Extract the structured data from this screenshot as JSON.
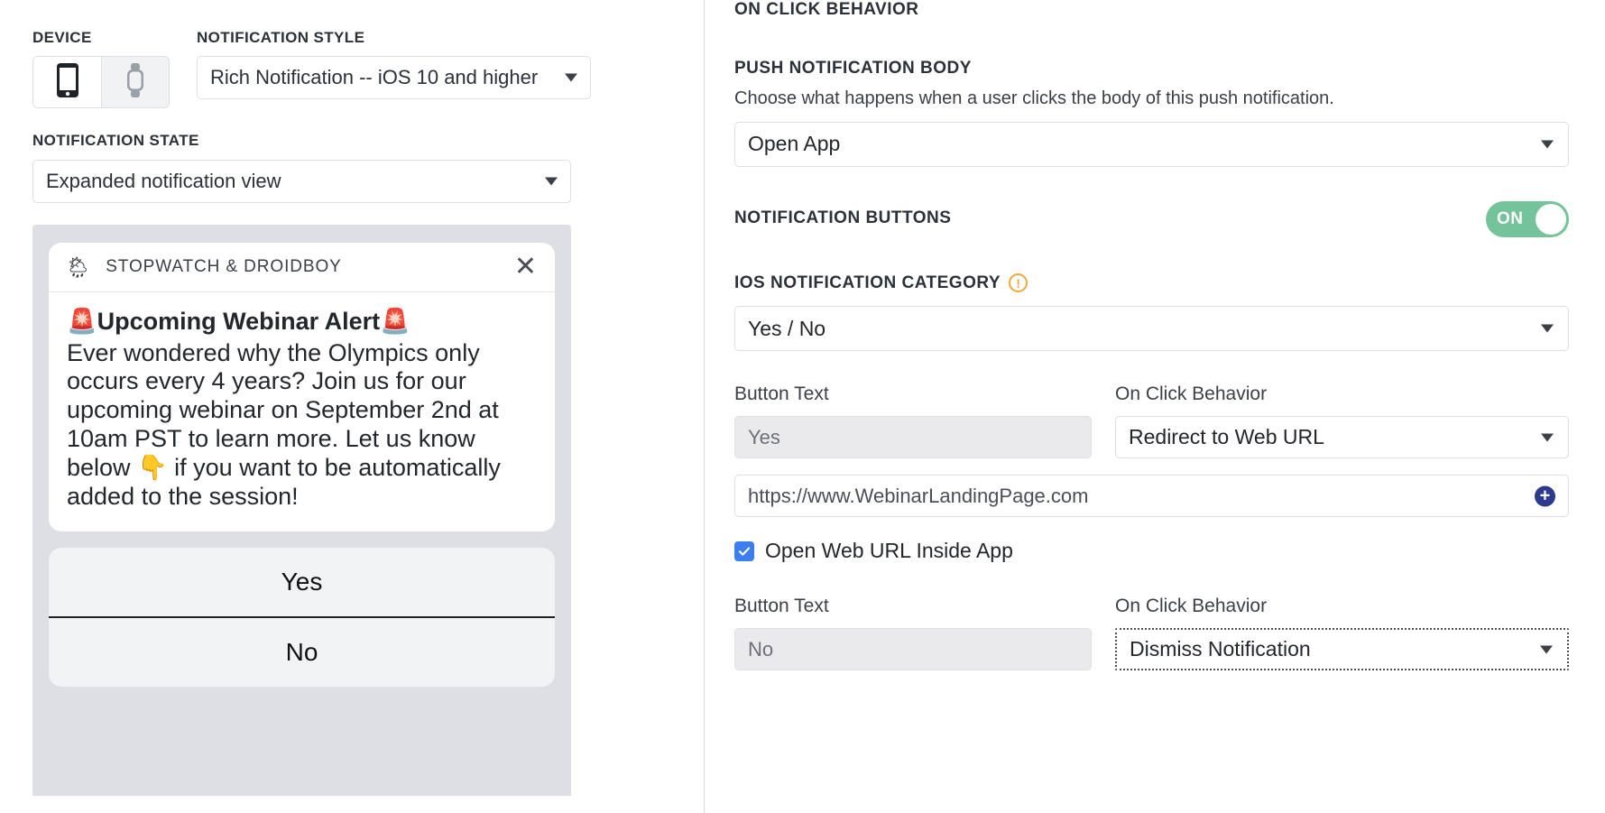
{
  "left": {
    "device": {
      "label": "DEVICE",
      "options": [
        {
          "name": "phone-icon",
          "selected": true
        },
        {
          "name": "watch-icon",
          "selected": false
        }
      ]
    },
    "notification_style": {
      "label": "NOTIFICATION STYLE",
      "value": "Rich Notification -- iOS 10 and higher"
    },
    "notification_state": {
      "label": "NOTIFICATION STATE",
      "value": "Expanded notification view"
    },
    "preview": {
      "app_icon": "🌦",
      "app_name": "STOPWATCH & DROIDBOY",
      "close_label": "✕",
      "title": "🚨Upcoming Webinar Alert🚨",
      "body": "Ever wondered why the Olympics only occurs every 4 years? Join us for our upcoming webinar on September 2nd at 10am PST to learn more. Let us know below 👇 if you want to be automatically added to the session!",
      "actions": [
        "Yes",
        "No"
      ]
    }
  },
  "right": {
    "on_click_behavior_heading": "ON CLICK BEHAVIOR",
    "push_body": {
      "label": "PUSH NOTIFICATION BODY",
      "description": "Choose what happens when a user clicks the body of this push notification.",
      "value": "Open App"
    },
    "notification_buttons": {
      "label": "NOTIFICATION BUTTONS",
      "toggle_state": "ON"
    },
    "ios_category": {
      "label": "IOS NOTIFICATION CATEGORY",
      "warning_glyph": "!",
      "value": "Yes / No"
    },
    "buttons": [
      {
        "text_label": "Button Text",
        "text_value": "Yes",
        "behavior_label": "On Click Behavior",
        "behavior_value": "Redirect to Web URL",
        "url_value": "https://www.WebinarLandingPage.com",
        "add_glyph": "+",
        "checkbox_label": "Open Web URL Inside App"
      },
      {
        "text_label": "Button Text",
        "text_value": "No",
        "behavior_label": "On Click Behavior",
        "behavior_value": "Dismiss Notification"
      }
    ]
  },
  "colors": {
    "toggle_on": "#74c49b",
    "checkbox": "#3c7ef0",
    "warning": "#f0a83a",
    "add_button": "#2b3a8f"
  }
}
